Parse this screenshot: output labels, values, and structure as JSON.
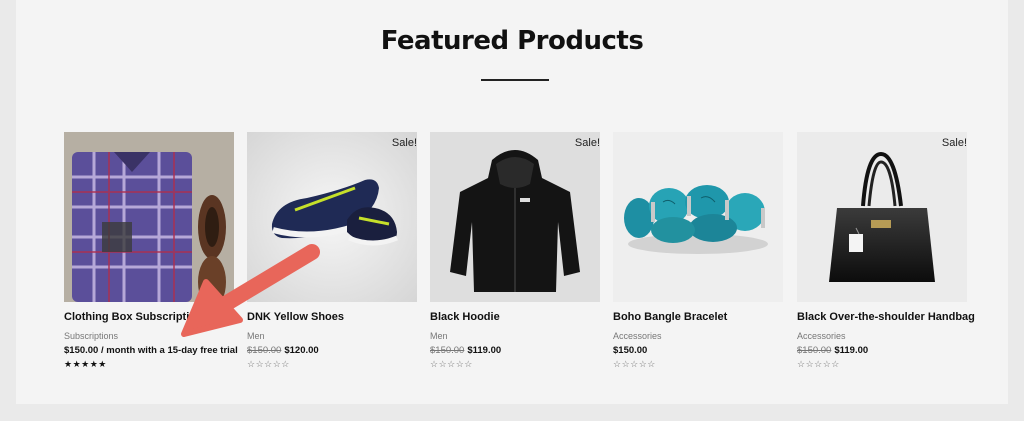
{
  "section": {
    "title": "Featured Products"
  },
  "products": [
    {
      "title": "Clothing Box Subscription",
      "category": "Subscriptions",
      "old_price": "",
      "price": "$150.00 / month with a 15-day free trial",
      "sale_badge": "",
      "rating": 5,
      "stars": "★★★★★",
      "image": "plaid-shirt-flatlay"
    },
    {
      "title": "DNK Yellow Shoes",
      "category": "Men",
      "old_price": "$150.00",
      "price": "$120.00",
      "sale_badge": "Sale!",
      "rating": 0,
      "stars": "☆☆☆☆☆",
      "image": "sneakers"
    },
    {
      "title": "Black Hoodie",
      "category": "Men",
      "old_price": "$150.00",
      "price": "$119.00",
      "sale_badge": "Sale!",
      "rating": 0,
      "stars": "☆☆☆☆☆",
      "image": "black-hoodie"
    },
    {
      "title": "Boho Bangle Bracelet",
      "category": "Accessories",
      "old_price": "",
      "price": "$150.00",
      "sale_badge": "",
      "rating": 0,
      "stars": "☆☆☆☆☆",
      "image": "turquoise-bracelet"
    },
    {
      "title": "Black Over-the-shoulder Handbag",
      "category": "Accessories",
      "old_price": "$150.00",
      "price": "$119.00",
      "sale_badge": "Sale!",
      "rating": 0,
      "stars": "☆☆☆☆☆",
      "image": "black-handbag"
    }
  ],
  "annotation": {
    "type": "arrow",
    "color": "#e8665a",
    "points_to": "subscription-price"
  },
  "colors": {
    "page_bg": "#f4f4f4",
    "arrow": "#e8665a",
    "text": "#111111",
    "muted": "#777777"
  }
}
